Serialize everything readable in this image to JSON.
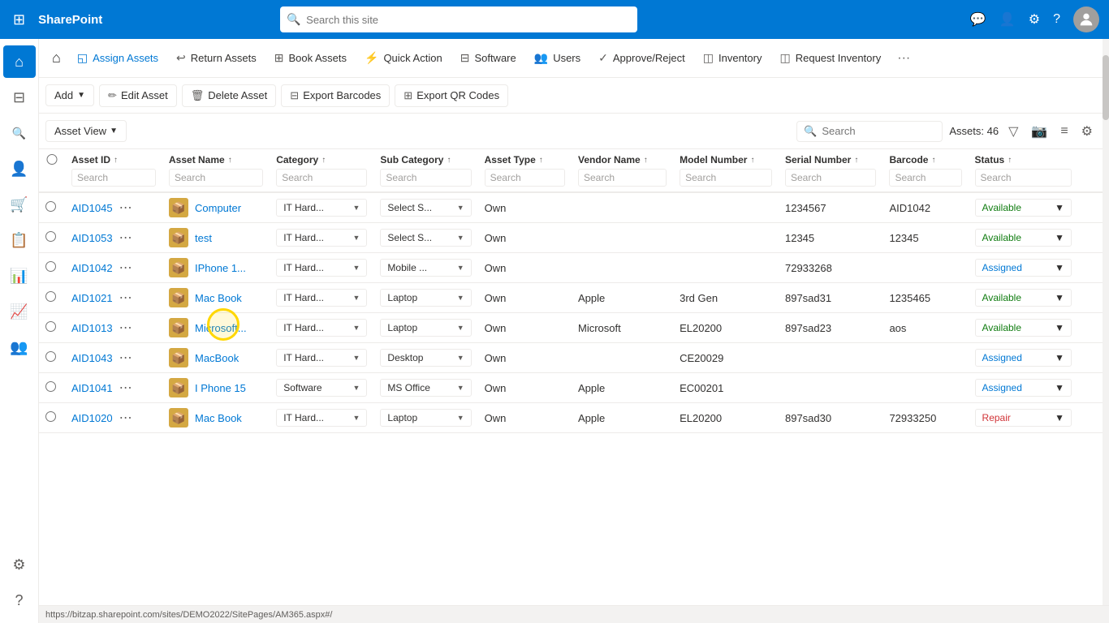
{
  "topbar": {
    "app_name": "SharePoint",
    "search_placeholder": "Search this site"
  },
  "ribbon": {
    "home_icon": "⌂",
    "buttons": [
      {
        "id": "assign-assets",
        "label": "Assign Assets",
        "icon": "◱",
        "active": true
      },
      {
        "id": "return-assets",
        "label": "Return Assets",
        "icon": "↩"
      },
      {
        "id": "book-assets",
        "label": "Book Assets",
        "icon": "⊞"
      },
      {
        "id": "quick-action",
        "label": "Quick Action",
        "icon": "⚡"
      },
      {
        "id": "software",
        "label": "Software",
        "icon": "⊟"
      },
      {
        "id": "users",
        "label": "Users",
        "icon": "👥"
      },
      {
        "id": "approve-reject",
        "label": "Approve/Reject",
        "icon": "✓"
      },
      {
        "id": "inventory",
        "label": "Inventory",
        "icon": "◫"
      },
      {
        "id": "request-inventory",
        "label": "Request Inventory",
        "icon": "◫"
      }
    ],
    "more_label": "···"
  },
  "toolbar": {
    "add_label": "Add",
    "edit_label": "Edit Asset",
    "delete_label": "Delete Asset",
    "export_barcodes_label": "Export Barcodes",
    "export_qr_label": "Export QR Codes"
  },
  "viewbar": {
    "view_label": "Asset View",
    "search_placeholder": "Search",
    "assets_count": "Assets: 46"
  },
  "table": {
    "columns": [
      {
        "id": "asset-id",
        "label": "Asset ID",
        "sort": "↑"
      },
      {
        "id": "asset-name",
        "label": "Asset Name",
        "sort": "↑"
      },
      {
        "id": "category",
        "label": "Category",
        "sort": "↑"
      },
      {
        "id": "sub-category",
        "label": "Sub Category",
        "sort": "↑"
      },
      {
        "id": "asset-type",
        "label": "Asset Type",
        "sort": "↑"
      },
      {
        "id": "vendor-name",
        "label": "Vendor Name",
        "sort": "↑"
      },
      {
        "id": "model-number",
        "label": "Model Number",
        "sort": "↑"
      },
      {
        "id": "serial-number",
        "label": "Serial Number",
        "sort": "↑"
      },
      {
        "id": "barcode",
        "label": "Barcode",
        "sort": "↑"
      },
      {
        "id": "status",
        "label": "Status",
        "sort": "↑"
      }
    ],
    "search_placeholder": "Search",
    "rows": [
      {
        "asset_id": "AID1045",
        "asset_name": "Computer",
        "category": "IT Hard...",
        "sub_category": "Select S...",
        "asset_type": "Own",
        "vendor_name": "",
        "model_number": "",
        "serial_number": "1234567",
        "barcode": "AID1042",
        "status": "Available",
        "status_class": "available"
      },
      {
        "asset_id": "AID1053",
        "asset_name": "test",
        "category": "IT Hard...",
        "sub_category": "Select S...",
        "asset_type": "Own",
        "vendor_name": "",
        "model_number": "",
        "serial_number": "12345",
        "barcode": "12345",
        "status": "Available",
        "status_class": "available"
      },
      {
        "asset_id": "AID1042",
        "asset_name": "IPhone 1...",
        "category": "IT Hard...",
        "sub_category": "Mobile ...",
        "asset_type": "Own",
        "vendor_name": "",
        "model_number": "",
        "serial_number": "72933268",
        "barcode": "",
        "status": "Assigned",
        "status_class": "assigned"
      },
      {
        "asset_id": "AID1021",
        "asset_name": "Mac Book",
        "category": "IT Hard...",
        "sub_category": "Laptop",
        "asset_type": "Own",
        "vendor_name": "Apple",
        "model_number": "3rd Gen",
        "serial_number": "897sad31",
        "barcode": "1235465",
        "status": "Available",
        "status_class": "available"
      },
      {
        "asset_id": "AID1013",
        "asset_name": "Microsoft...",
        "category": "IT Hard...",
        "sub_category": "Laptop",
        "asset_type": "Own",
        "vendor_name": "Microsoft",
        "model_number": "EL20200",
        "serial_number": "897sad23",
        "barcode": "aos",
        "status": "Available",
        "status_class": "available"
      },
      {
        "asset_id": "AID1043",
        "asset_name": "MacBook",
        "category": "IT Hard...",
        "sub_category": "Desktop",
        "asset_type": "Own",
        "vendor_name": "",
        "model_number": "CE20029",
        "serial_number": "",
        "barcode": "",
        "status": "Assigned",
        "status_class": "assigned"
      },
      {
        "asset_id": "AID1041",
        "asset_name": "I Phone 15",
        "category": "Software",
        "sub_category": "MS Office",
        "asset_type": "Own",
        "vendor_name": "Apple",
        "model_number": "EC00201",
        "serial_number": "",
        "barcode": "",
        "status": "Assigned",
        "status_class": "assigned"
      },
      {
        "asset_id": "AID1020",
        "asset_name": "Mac Book",
        "category": "IT Hard...",
        "sub_category": "Laptop",
        "asset_type": "Own",
        "vendor_name": "Apple",
        "model_number": "EL20200",
        "serial_number": "897sad30",
        "barcode": "72933250",
        "status": "Repair",
        "status_class": "repair"
      }
    ]
  },
  "statusbar": {
    "url": "https://bitzap.sharepoint.com/sites/DEMO2022/SitePages/AM365.aspx#/"
  },
  "sidebar": {
    "items": [
      {
        "id": "home",
        "icon": "⌂",
        "active": true
      },
      {
        "id": "dashboard",
        "icon": "⊟"
      },
      {
        "id": "search",
        "icon": "🔍"
      },
      {
        "id": "people",
        "icon": "👤"
      },
      {
        "id": "cart",
        "icon": "🛒"
      },
      {
        "id": "orders",
        "icon": "📋"
      },
      {
        "id": "reports",
        "icon": "📊"
      },
      {
        "id": "analytics",
        "icon": "📈"
      },
      {
        "id": "users2",
        "icon": "👥"
      },
      {
        "id": "settings",
        "icon": "⚙"
      },
      {
        "id": "help",
        "icon": "?"
      }
    ]
  }
}
